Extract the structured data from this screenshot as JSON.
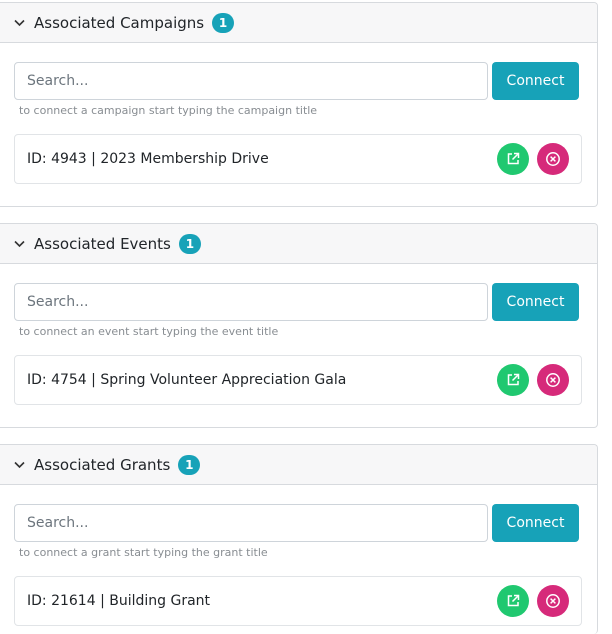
{
  "panels": [
    {
      "title": "Associated Campaigns",
      "count": "1",
      "search_placeholder": "Search...",
      "connect_label": "Connect",
      "hint": "to connect a campaign start typing the campaign title",
      "items": [
        {
          "label": "ID: 4943 | 2023 Membership Drive"
        }
      ]
    },
    {
      "title": "Associated Events",
      "count": "1",
      "search_placeholder": "Search...",
      "connect_label": "Connect",
      "hint": "to connect an event start typing the event title",
      "items": [
        {
          "label": "ID: 4754 | Spring Volunteer Appreciation Gala"
        }
      ]
    },
    {
      "title": "Associated Grants",
      "count": "1",
      "search_placeholder": "Search...",
      "connect_label": "Connect",
      "hint": "to connect a grant start typing the grant title",
      "items": [
        {
          "label": "ID: 21614 | Building Grant"
        }
      ]
    }
  ],
  "colors": {
    "accent": "#17a2b8",
    "open_button": "#20c870",
    "remove_button": "#d62a7a"
  },
  "icons": {
    "collapse": "chevron-down-icon",
    "open": "external-link-icon",
    "remove": "close-circle-icon"
  }
}
